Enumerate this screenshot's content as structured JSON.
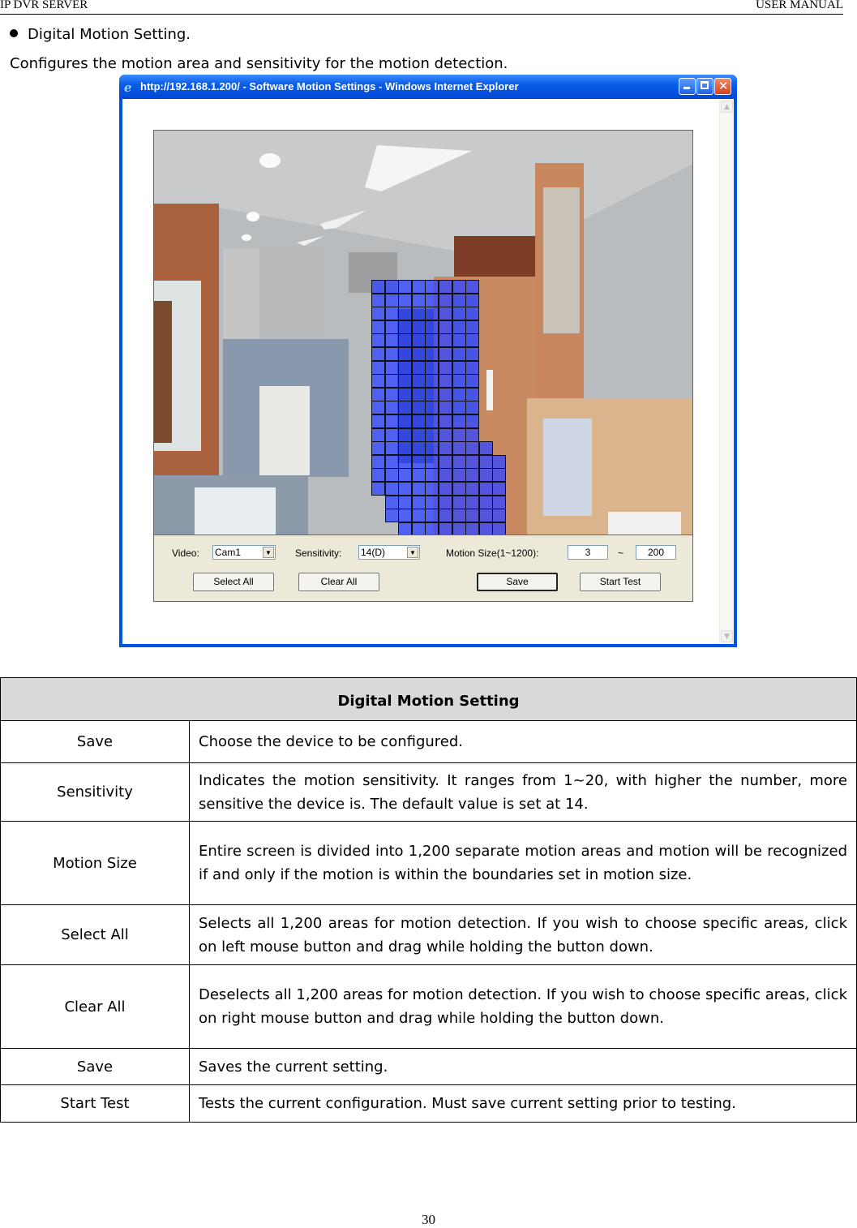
{
  "header": {
    "left": "IP DVR SERVER",
    "right": "USER MANUAL"
  },
  "section": {
    "bullet": "Digital Motion Setting.",
    "intro": "Configures the motion area and sensitivity for the motion detection."
  },
  "window": {
    "title": "http://192.168.1.200/ - Software Motion Settings - Windows Internet Explorer",
    "icons": {
      "app": "ie-icon",
      "minimize": "minimize-icon",
      "maximize": "maximize-icon",
      "close": "close-icon"
    },
    "controls": {
      "video_label": "Video:",
      "video_value": "Cam1",
      "sensitivity_label": "Sensitivity:",
      "sensitivity_value": "14(D)",
      "motion_size_label": "Motion Size(1~1200):",
      "motion_size_min": "3",
      "motion_size_sep": "~",
      "motion_size_max": "200",
      "select_all": "Select All",
      "clear_all": "Clear All",
      "save": "Save",
      "start_test": "Start Test"
    },
    "motion_grid_rows": [
      [
        0,
        7
      ],
      [
        0,
        7
      ],
      [
        0,
        7
      ],
      [
        0,
        7
      ],
      [
        0,
        7
      ],
      [
        0,
        7
      ],
      [
        0,
        7
      ],
      [
        0,
        7
      ],
      [
        0,
        7
      ],
      [
        0,
        7
      ],
      [
        0,
        7
      ],
      [
        0,
        7
      ],
      [
        0,
        8
      ],
      [
        0,
        9
      ],
      [
        0,
        9
      ],
      [
        0,
        9
      ],
      [
        1,
        9
      ],
      [
        1,
        9
      ],
      [
        2,
        9
      ]
    ],
    "grid_color": "#3246ff"
  },
  "table": {
    "title": "Digital Motion Setting",
    "rows": [
      {
        "key": "Save",
        "value": "Choose the device to be configured."
      },
      {
        "key": "Sensitivity",
        "value": "Indicates the motion sensitivity. It ranges from 1~20, with higher the number, more sensitive the device is. The default value is set at 14."
      },
      {
        "key": "Motion Size",
        "value": "Entire screen is divided into 1,200 separate motion areas and motion will be recognized if and only if the motion is within the boundaries set in motion size."
      },
      {
        "key": "Select All",
        "value": "Selects all 1,200 areas for motion detection. If you wish to choose specific areas, click on left mouse button and drag while holding the button down."
      },
      {
        "key": "Clear All",
        "value": "Deselects all 1,200 areas for motion detection. If you wish to choose specific areas, click on right mouse button and drag while holding the button down."
      },
      {
        "key": "Save",
        "value": "Saves the current setting."
      },
      {
        "key": "Start Test",
        "value": "Tests the current configuration. Must save current setting prior to testing."
      }
    ]
  },
  "page_number": "30"
}
